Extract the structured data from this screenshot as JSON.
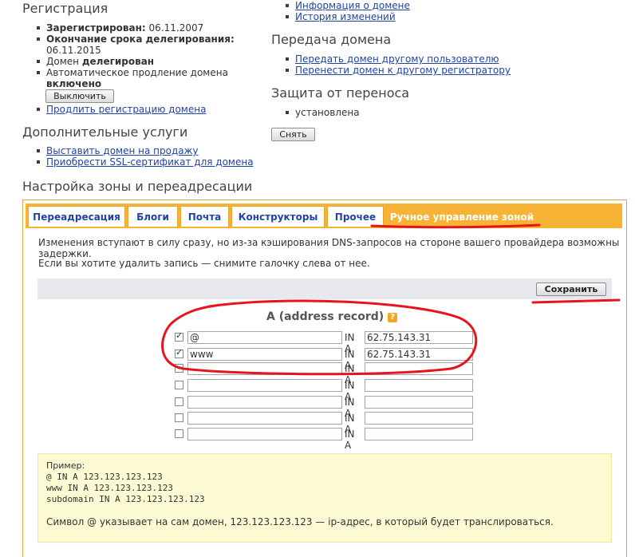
{
  "registration": {
    "title": "Регистрация",
    "registered_label": "Зарегистрирован:",
    "registered_value": "06.11.2007",
    "expiry_label": "Окончание срока делегирования:",
    "expiry_value": "06.11.2015",
    "domain_status_prefix": "Домен",
    "domain_status_value": "делегирован",
    "auto_renew_label": "Автоматическое продление домена",
    "auto_renew_value": "включено",
    "disable_button": "Выключить",
    "renew_link": "Продлить регистрацию домена"
  },
  "domain_links": {
    "info_link": "Информация о домене",
    "history_link": "История изменений"
  },
  "transfer": {
    "title": "Передача домена",
    "to_user_link": "Передать домен другому пользователю",
    "to_registrar_link": "Перенести домен к другому регистратору"
  },
  "protection": {
    "title": "Защита от переноса",
    "status": "установлена",
    "remove_button": "Снять"
  },
  "extra": {
    "title": "Дополнительные услуги",
    "sell_link": "Выставить домен на продажу",
    "ssl_link": "Приобрести SSL-сертификат для домена"
  },
  "zone": {
    "title": "Настройка зоны и переадресации",
    "tabs": [
      "Переадресация",
      "Блоги",
      "Почта",
      "Конструкторы",
      "Прочее",
      "Ручное управление зоной"
    ],
    "note1": "Изменения вступают в силу сразу, но из-за кэширования DNS-запросов на стороне вашего провайдера возможны задержки.",
    "note2": "Если вы хотите удалить запись — снимите галочку слева от нее.",
    "save_button": "Сохранить",
    "record_title": "A (address record)",
    "help_icon": "?",
    "in_a": "IN A",
    "records": [
      {
        "checked": true,
        "name": "@",
        "ip": "62.75.143.31"
      },
      {
        "checked": true,
        "name": "www",
        "ip": "62.75.143.31"
      },
      {
        "checked": false,
        "name": "",
        "ip": ""
      },
      {
        "checked": false,
        "name": "",
        "ip": ""
      },
      {
        "checked": false,
        "name": "",
        "ip": ""
      },
      {
        "checked": false,
        "name": "",
        "ip": ""
      },
      {
        "checked": false,
        "name": "",
        "ip": ""
      }
    ],
    "example": {
      "title": "Пример:",
      "lines": [
        "@ IN A 123.123.123.123",
        "www IN A 123.123.123.123",
        "subdomain IN A 123.123.123.123"
      ],
      "note": "Символ @ указывает на сам домен, 123.123.123.123 — ip-адрес, в который будет транслироваться."
    }
  },
  "colors": {
    "tab_bar": "#f7b336",
    "link": "#1f44a6",
    "annotation_red": "#e8141c"
  }
}
